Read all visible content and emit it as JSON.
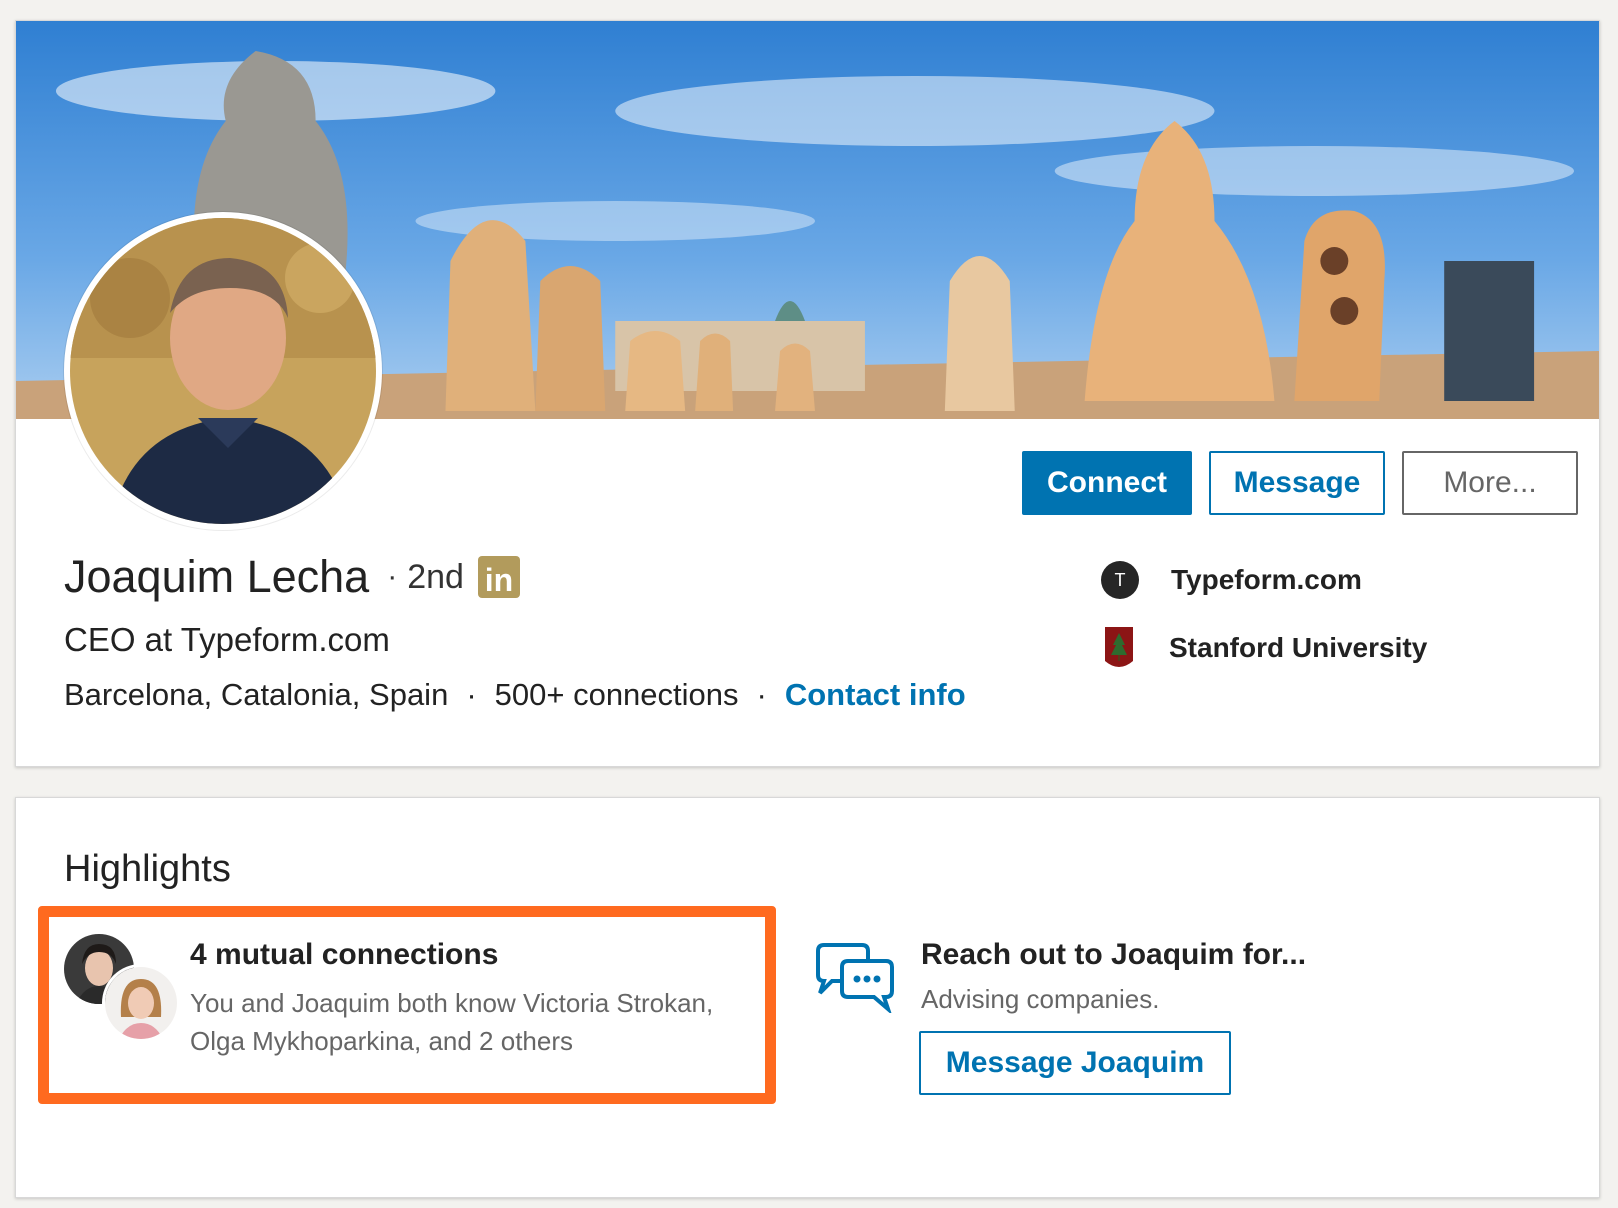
{
  "profile": {
    "name": "Joaquim Lecha",
    "degree_separator": "·",
    "degree": "2nd",
    "premium_badge": "in",
    "headline": "CEO at Typeform.com",
    "location": "Barcelona, Catalonia, Spain",
    "connections": "500+ connections",
    "contact_info": "Contact info",
    "separator": "·"
  },
  "actions": {
    "connect": "Connect",
    "message": "Message",
    "more": "More..."
  },
  "organizations": [
    {
      "name": "Typeform.com",
      "logo_letter": "T",
      "icon": "typeform-logo-icon"
    },
    {
      "name": "Stanford University",
      "icon": "stanford-logo-icon"
    }
  ],
  "highlights": {
    "title": "Highlights",
    "mutual": {
      "title": "4 mutual connections",
      "description": "You and Joaquim both know Victoria Strokan, Olga Mykhoparkina, and 2 others"
    },
    "reach_out": {
      "title": "Reach out to Joaquim for...",
      "description": "Advising companies.",
      "button": "Message Joaquim"
    }
  },
  "colors": {
    "linkedin_blue": "#0073b1",
    "highlight_border": "#ff6a1f",
    "premium_gold": "#b29b5c"
  }
}
